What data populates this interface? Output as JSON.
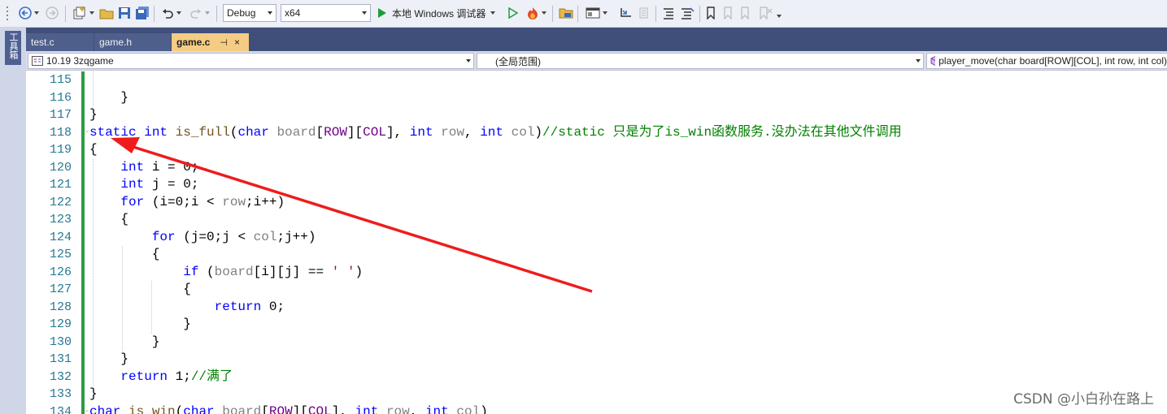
{
  "toolbar": {
    "config": "Debug",
    "platform": "x64",
    "run_label": "本地 Windows 调试器"
  },
  "sidebar": {
    "toolbox_label": "工具箱"
  },
  "tabs": [
    {
      "label": "test.c"
    },
    {
      "label": "game.h"
    },
    {
      "label": "game.c",
      "pin": "⊣",
      "close": "×"
    }
  ],
  "nav": {
    "project": "10.19 3zqgame",
    "scope": "(全局范围)",
    "member": "player_move(char board[ROW][COL], int row, int col)"
  },
  "editor": {
    "lines": [
      {
        "num": "115",
        "text": ""
      },
      {
        "num": "116",
        "text": "    }"
      },
      {
        "num": "117",
        "text": "}"
      },
      {
        "num": "118",
        "text": "static int is_full(char board[ROW][COL], int row, int col)//static 只是为了is_win函数服务.没办法在其他文件调用"
      },
      {
        "num": "119",
        "text": "{"
      },
      {
        "num": "120",
        "text": "    int i = 0;"
      },
      {
        "num": "121",
        "text": "    int j = 0;"
      },
      {
        "num": "122",
        "text": "    for (i=0;i < row;i++)"
      },
      {
        "num": "123",
        "text": "    {"
      },
      {
        "num": "124",
        "text": "        for (j=0;j < col;j++)"
      },
      {
        "num": "125",
        "text": "        {"
      },
      {
        "num": "126",
        "text": "            if (board[i][j] == ' ')"
      },
      {
        "num": "127",
        "text": "            {"
      },
      {
        "num": "128",
        "text": "                return 0;"
      },
      {
        "num": "129",
        "text": "            }"
      },
      {
        "num": "130",
        "text": "        }"
      },
      {
        "num": "131",
        "text": "    }"
      },
      {
        "num": "132",
        "text": "    return 1;//满了"
      },
      {
        "num": "133",
        "text": "}"
      },
      {
        "num": "134",
        "text": "char is_win(char board[ROW][COL], int row, int col)"
      }
    ]
  },
  "watermark": "CSDN @小白孙在路上",
  "colors": {
    "keyword": "#0000ff",
    "function": "#74531f",
    "macro": "#6f008a",
    "parameter": "#808080",
    "string": "#a31515",
    "comment": "#008000",
    "line_number": "#237893",
    "annotation_arrow": "#ee1c1c",
    "active_tab": "#f5cc84"
  }
}
